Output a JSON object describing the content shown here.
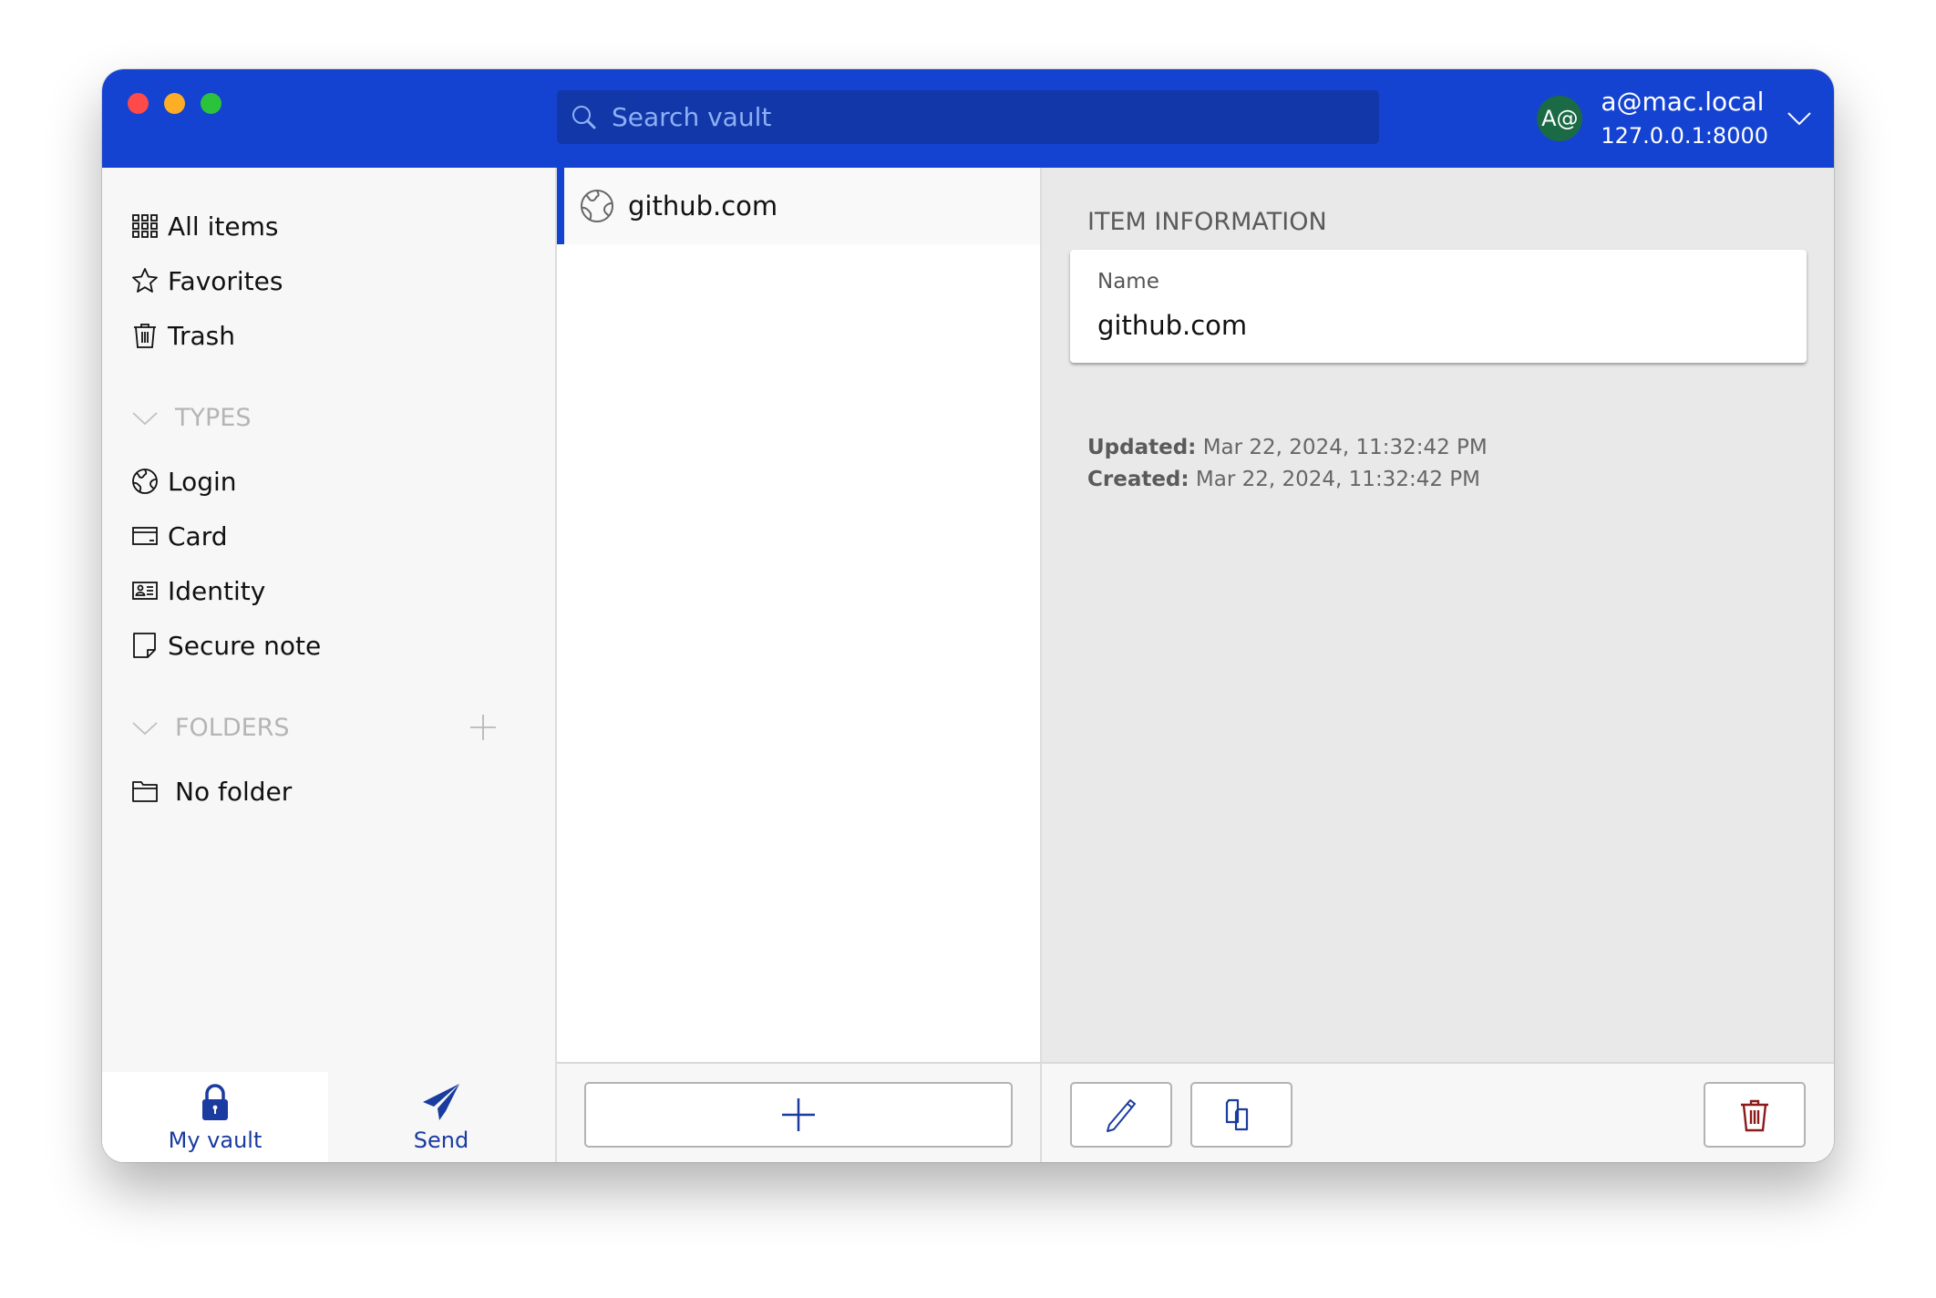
{
  "colors": {
    "brand": "#1543d1",
    "search_bg": "#1237a8",
    "avatar_bg": "#1b6a46",
    "accent_icon": "#1a3b9f",
    "danger": "#8b1a1a"
  },
  "window": {
    "traffic_lights": [
      "close",
      "minimize",
      "maximize"
    ]
  },
  "header": {
    "search": {
      "placeholder": "Search vault",
      "value": "",
      "icon": "search-icon"
    },
    "account": {
      "avatar_initials": "A@",
      "email": "a@mac.local",
      "server": "127.0.0.1:8000",
      "icon": "chevron-down-icon"
    }
  },
  "sidebar": {
    "items": [
      {
        "label": "All items",
        "icon": "grid-icon"
      },
      {
        "label": "Favorites",
        "icon": "star-icon"
      },
      {
        "label": "Trash",
        "icon": "trash-icon"
      }
    ],
    "types": {
      "heading": "TYPES",
      "items": [
        {
          "label": "Login",
          "icon": "globe-icon"
        },
        {
          "label": "Card",
          "icon": "credit-card-icon"
        },
        {
          "label": "Identity",
          "icon": "id-card-icon"
        },
        {
          "label": "Secure note",
          "icon": "note-icon"
        }
      ]
    },
    "folders": {
      "heading": "FOLDERS",
      "add_icon": "plus-icon",
      "items": [
        {
          "label": "No folder",
          "icon": "folder-icon"
        }
      ]
    },
    "bottom_tabs": [
      {
        "label": "My vault",
        "icon": "lock-icon",
        "active": true
      },
      {
        "label": "Send",
        "icon": "paper-plane-icon",
        "active": false
      }
    ]
  },
  "list": {
    "items": [
      {
        "name": "github.com",
        "icon": "globe-icon",
        "selected": true
      }
    ],
    "add_button_icon": "plus-icon"
  },
  "detail": {
    "section_title": "ITEM INFORMATION",
    "fields": [
      {
        "label": "Name",
        "value": "github.com"
      }
    ],
    "updated_label": "Updated:",
    "updated_value": "Mar 22, 2024, 11:32:42 PM",
    "created_label": "Created:",
    "created_value": "Mar 22, 2024, 11:32:42 PM",
    "actions": [
      {
        "name": "edit",
        "icon": "pencil-icon"
      },
      {
        "name": "clone",
        "icon": "clone-icon"
      },
      {
        "name": "delete",
        "icon": "trash-icon"
      }
    ]
  }
}
